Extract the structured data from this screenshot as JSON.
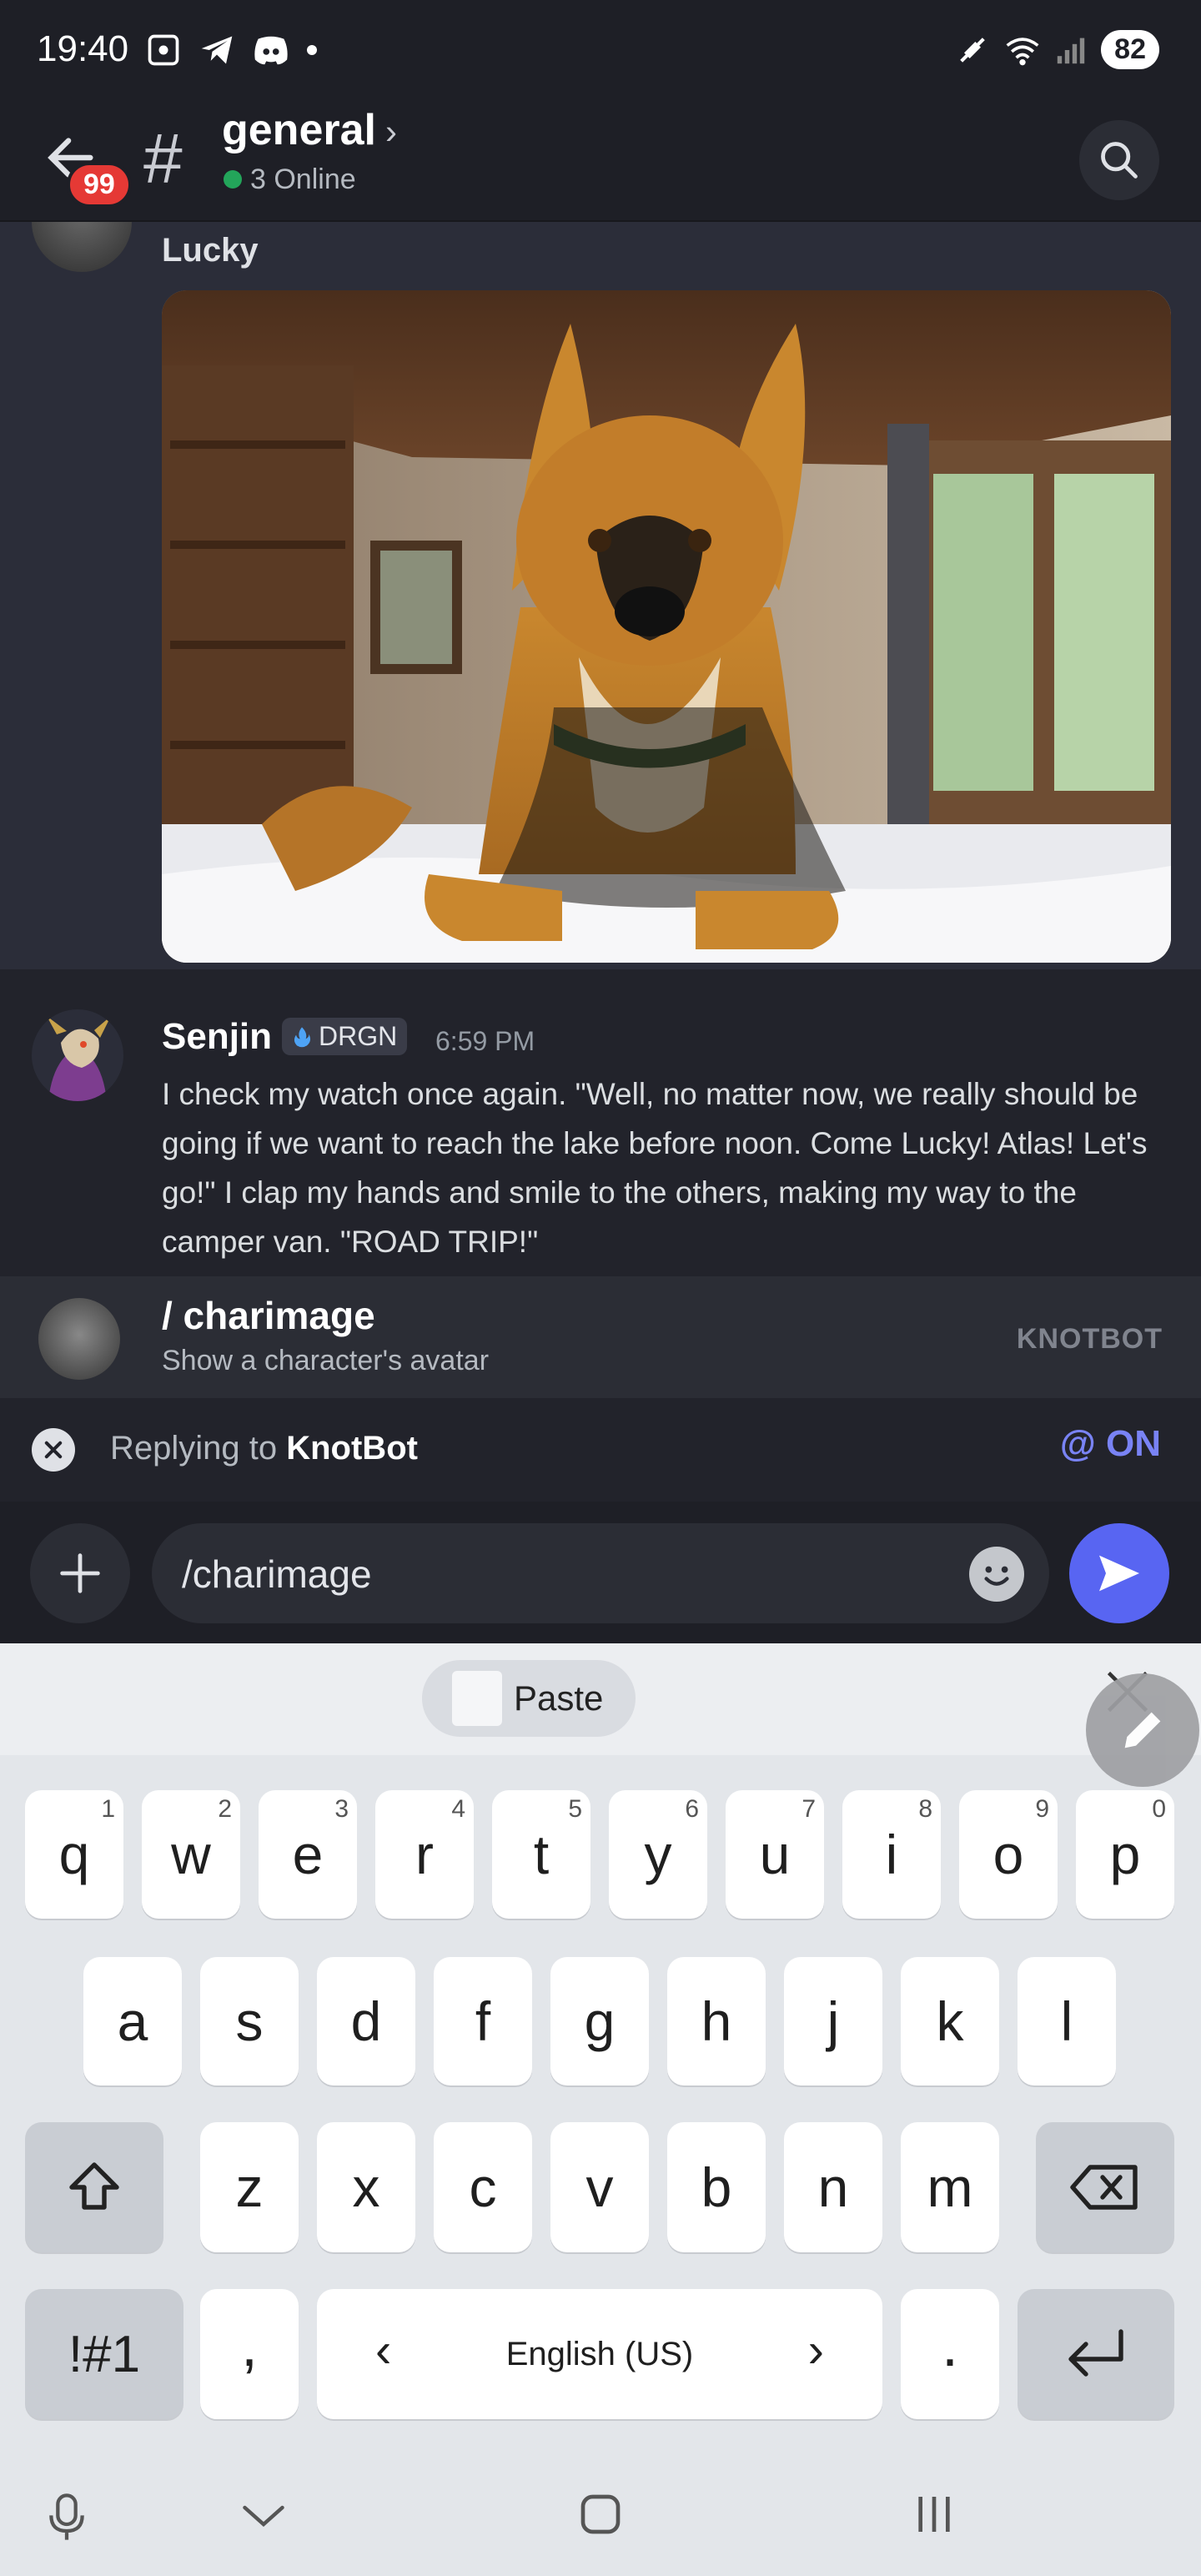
{
  "status_bar": {
    "time": "19:40",
    "battery": "82"
  },
  "header": {
    "back_badge": "99",
    "channel_name": "general",
    "online_status": "3 Online"
  },
  "messages": [
    {
      "author": "Lucky",
      "has_image": true
    },
    {
      "author": "Senjin",
      "tag": "DRGN",
      "time": "6:59 PM",
      "text": "I check my watch once again. \"Well, no matter now, we really should be going if we want to reach the lake before noon. Come Lucky! Atlas! Let's go!\" I clap my hands and smile to the others, making my way to the camper van. \"ROAD TRIP!\""
    }
  ],
  "suggestion": {
    "command": "/ charimage",
    "description": "Show a character's avatar",
    "bot": "KNOTBOT"
  },
  "reply_bar": {
    "prefix": "Replying to ",
    "user": "KnotBot",
    "mention_label": "@ ON"
  },
  "composer": {
    "input_value": "/charimage"
  },
  "keyboard": {
    "paste_label": "Paste",
    "row1": [
      {
        "key": "q",
        "hint": "1"
      },
      {
        "key": "w",
        "hint": "2"
      },
      {
        "key": "e",
        "hint": "3"
      },
      {
        "key": "r",
        "hint": "4"
      },
      {
        "key": "t",
        "hint": "5"
      },
      {
        "key": "y",
        "hint": "6"
      },
      {
        "key": "u",
        "hint": "7"
      },
      {
        "key": "i",
        "hint": "8"
      },
      {
        "key": "o",
        "hint": "9"
      },
      {
        "key": "p",
        "hint": "0"
      }
    ],
    "row2": [
      "a",
      "s",
      "d",
      "f",
      "g",
      "h",
      "j",
      "k",
      "l"
    ],
    "row3": [
      "z",
      "x",
      "c",
      "v",
      "b",
      "n",
      "m"
    ],
    "symbols_label": "!#1",
    "comma": ",",
    "space_label": "English (US)",
    "period": "."
  }
}
